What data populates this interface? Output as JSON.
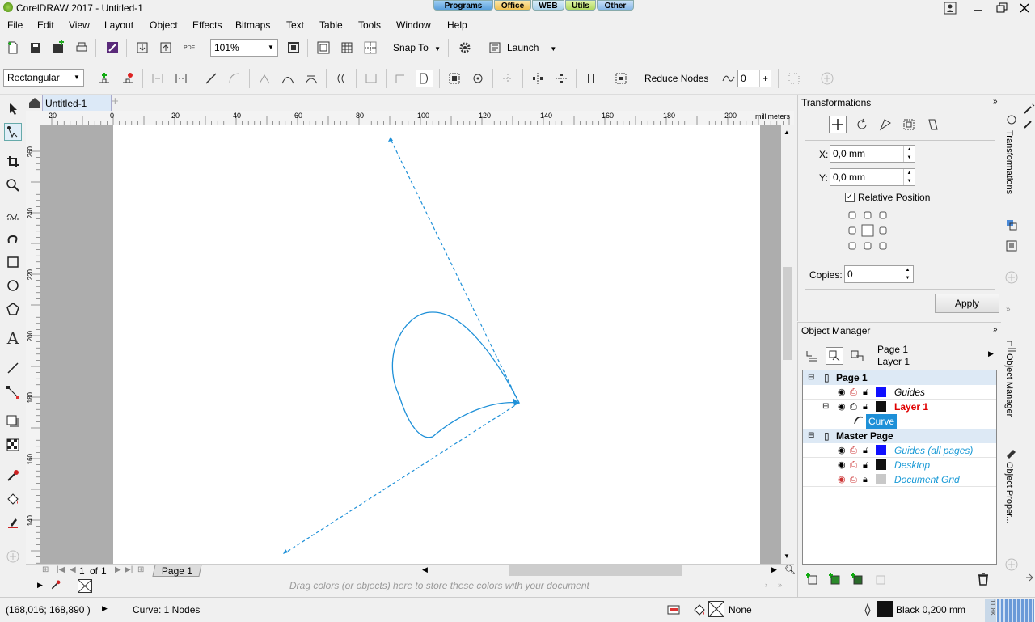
{
  "app": {
    "title": "CorelDRAW 2017 - Untitled-1"
  },
  "workspace_tabs": [
    "Programs",
    "Office",
    "WEB",
    "Utils",
    "Other"
  ],
  "menu": [
    "File",
    "Edit",
    "View",
    "Layout",
    "Object",
    "Effects",
    "Bitmaps",
    "Text",
    "Table",
    "Tools",
    "Window",
    "Help"
  ],
  "toolbar": {
    "zoom": "101%",
    "snap_to": "Snap To",
    "launch": "Launch",
    "pdf": "PDF"
  },
  "property_bar": {
    "selection_mode": "Rectangular",
    "reduce_nodes": "Reduce Nodes",
    "smoothness": "0"
  },
  "doc": {
    "tab": "Untitled-1"
  },
  "ruler": {
    "units": "millimeters",
    "h_ticks": [
      "20",
      "0",
      "20",
      "40",
      "60",
      "80",
      "100",
      "120",
      "140",
      "160",
      "180",
      "200"
    ],
    "v_ticks": [
      "260",
      "240",
      "220",
      "200",
      "180",
      "160",
      "140"
    ]
  },
  "pages": {
    "current": "1",
    "of": "of",
    "total": "1",
    "tab": "Page 1"
  },
  "palette_hint": "Drag colors (or objects) here to store these colors with your document",
  "status": {
    "coords": "(168,016; 168,890 )",
    "selection": "Curve: 1 Nodes",
    "fill": "None",
    "outline": "Black  0,200 mm"
  },
  "transformations": {
    "title": "Transformations",
    "x_label": "X:",
    "x_value": "0,0 mm",
    "y_label": "Y:",
    "y_value": "0,0 mm",
    "relative": "Relative Position",
    "copies_label": "Copies:",
    "copies_value": "0",
    "apply": "Apply"
  },
  "object_manager": {
    "title": "Object Manager",
    "header_page": "Page 1",
    "header_layer": "Layer 1",
    "rows": {
      "page1": "Page 1",
      "guides": "Guides",
      "layer1": "Layer 1",
      "curve": "Curve",
      "master": "Master Page",
      "guides_all": "Guides (all pages)",
      "desktop": "Desktop",
      "docgrid": "Document Grid"
    }
  },
  "side_tabs": {
    "transformations": "Transformations",
    "object_manager": "Object Manager",
    "object_properties": "Object Proper..."
  },
  "colors": {
    "accent": "#1e90d8",
    "layer_red": "#e00000",
    "guides_blue": "#1010ff",
    "master_blue": "#1a9ad6"
  },
  "icons": {
    "home": "home-icon",
    "apply": "apply-button"
  }
}
